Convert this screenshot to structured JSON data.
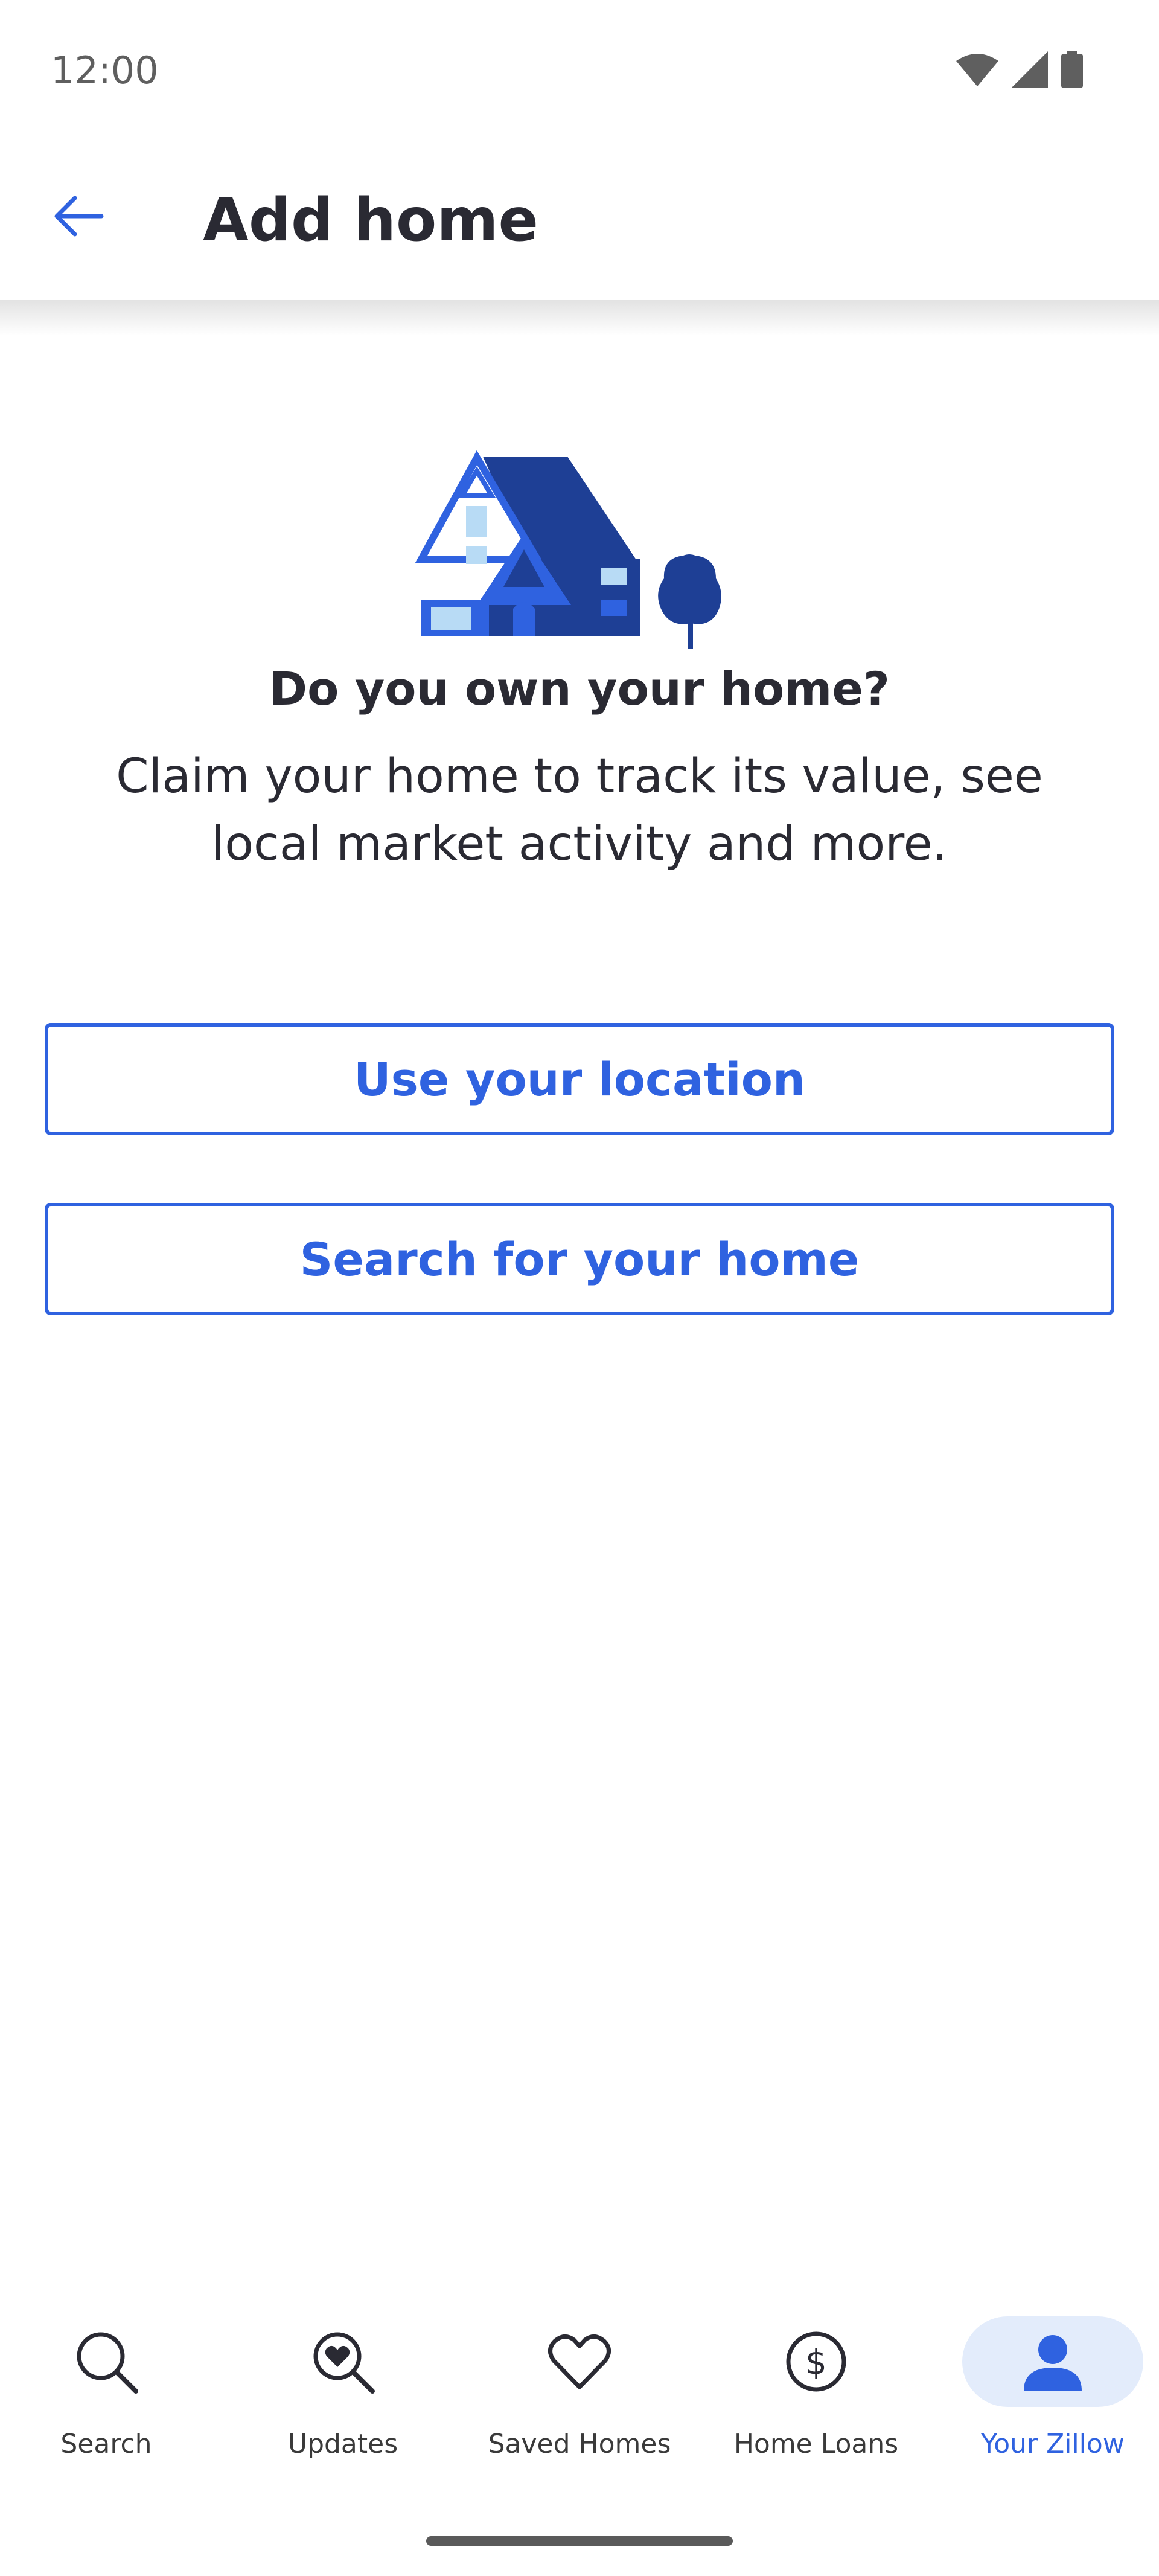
{
  "status_bar": {
    "time": "12:00",
    "icons": [
      "wifi-icon",
      "cellular-signal-icon",
      "battery-icon"
    ]
  },
  "app_bar": {
    "back_icon": "arrow-left-icon",
    "title": "Add home"
  },
  "hero": {
    "illustration": "house-illustration"
  },
  "content": {
    "headline": "Do you own your home?",
    "subtext": "Claim your home to track its value, see local market activity and more."
  },
  "buttons": {
    "use_location": "Use your location",
    "search_home": "Search for your home"
  },
  "bottom_nav": {
    "items": [
      {
        "label": "Search",
        "icon": "search-icon",
        "active": false
      },
      {
        "label": "Updates",
        "icon": "updates-icon",
        "active": false
      },
      {
        "label": "Saved Homes",
        "icon": "heart-icon",
        "active": false
      },
      {
        "label": "Home Loans",
        "icon": "dollar-circle-icon",
        "active": false
      },
      {
        "label": "Your Zillow",
        "icon": "person-icon",
        "active": true
      }
    ]
  },
  "colors": {
    "accent": "#2f62e0",
    "text": "#2a2a33",
    "active_nav_bg": "#e3ecfb",
    "house_dark": "#1e3f95",
    "house_mid": "#2f62e0",
    "house_light": "#b8dbf5"
  }
}
